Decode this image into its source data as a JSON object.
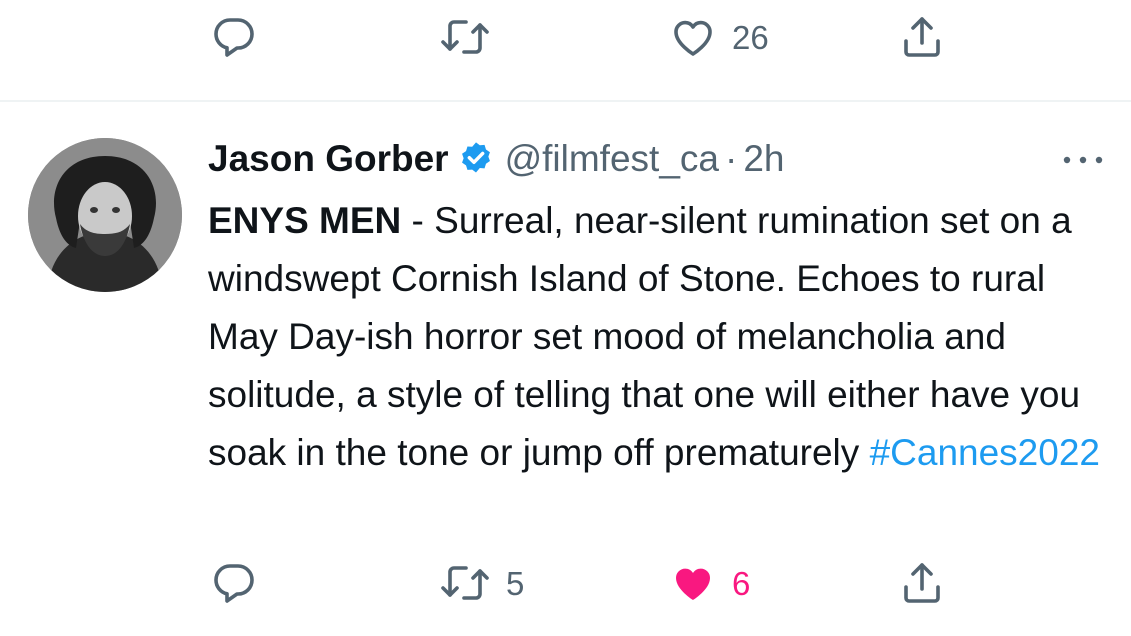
{
  "previous_tweet": {
    "like_count": "26"
  },
  "tweet": {
    "author_name": "Jason Gorber",
    "handle": "@filmfest_ca",
    "separator": "·",
    "time": "2h",
    "text_bold": "ENYS MEN",
    "text_rest": " - Surreal, near-silent rumination set on a windswept Cornish Island of Stone. Echoes to rural May Day-ish horror set mood of melancholia and solitude, a style of telling that one will either have you soak in the tone or jump off prematurely ",
    "hashtag": "#Cannes2022",
    "retweet_count": "5",
    "like_count": "6",
    "liked": true
  },
  "icons": {
    "reply": "reply-icon",
    "retweet": "retweet-icon",
    "like": "heart-icon",
    "share": "share-icon",
    "verified": "verified-badge-icon",
    "more": "more-options-icon"
  },
  "colors": {
    "icon_gray": "#536471",
    "like_pink": "#f91880",
    "link_blue": "#1d9bf0",
    "verified_blue": "#1d9bf0",
    "divider": "#eff3f4"
  }
}
